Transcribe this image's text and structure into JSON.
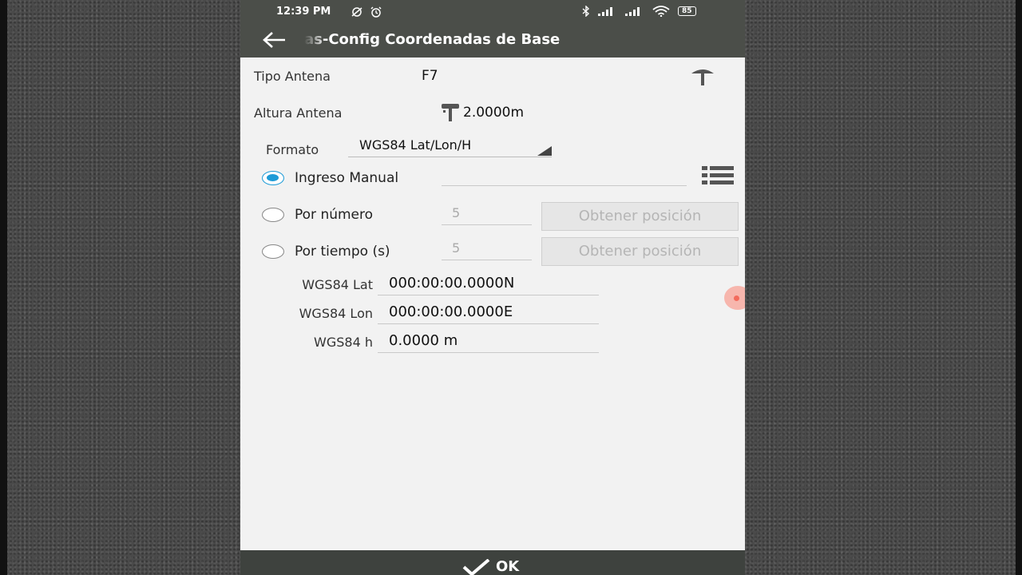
{
  "status_bar": {
    "time": "12:39 PM",
    "battery": "85"
  },
  "app_bar": {
    "title": "as-Config Coordenadas de Base"
  },
  "antenna": {
    "type_label": "Tipo Antena",
    "type_value": "F7",
    "height_label": "Altura Antena",
    "height_value": "2.0000m"
  },
  "format": {
    "label": "Formato",
    "selected": "WGS84 Lat/Lon/H"
  },
  "input_mode": {
    "manual": {
      "label": "Ingreso Manual",
      "value": ""
    },
    "by_number": {
      "label": "Por número",
      "value": "5",
      "button": "Obtener posición"
    },
    "by_time": {
      "label": "Por tiempo (s)",
      "value": "5",
      "button": "Obtener posición"
    }
  },
  "coords": {
    "lat": {
      "label": "WGS84 Lat",
      "value": "000:00:00.0000N"
    },
    "lon": {
      "label": "WGS84 Lon",
      "value": "000:00:00.0000E"
    },
    "h": {
      "label": "WGS84 h",
      "value": "0.0000 m"
    }
  },
  "footer": {
    "ok_label": "OK"
  },
  "colors": {
    "bar": "#4b4e49",
    "accent": "#1d9bd7",
    "fab": "#f36b5c"
  }
}
